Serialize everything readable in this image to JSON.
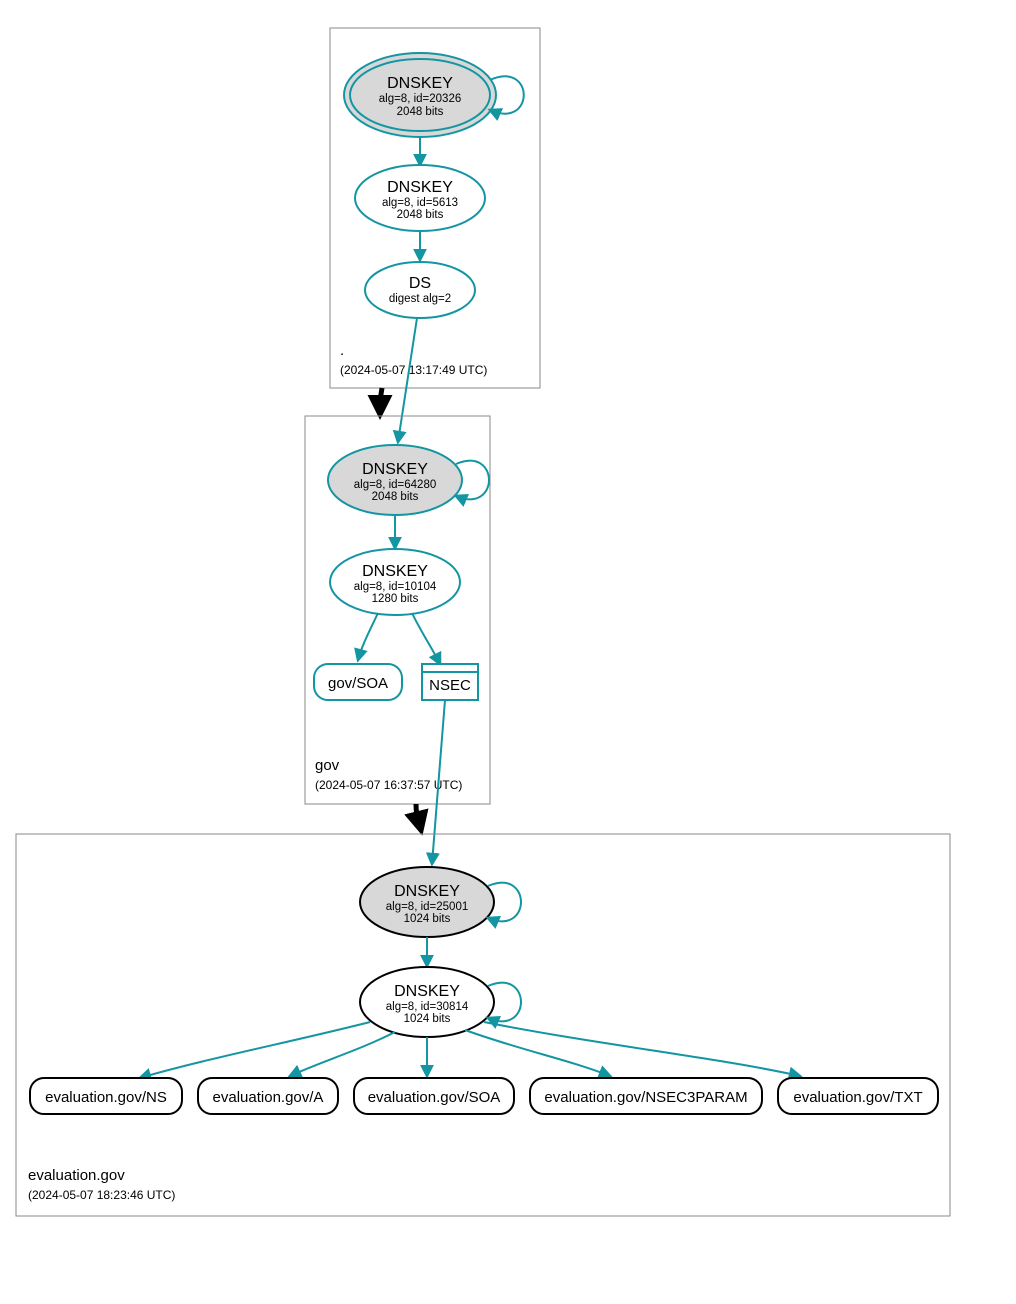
{
  "zones": {
    "root": {
      "label": ".",
      "timestamp": "(2024-05-07 13:17:49 UTC)",
      "dnskey_ksk": {
        "title": "DNSKEY",
        "line1": "alg=8, id=20326",
        "line2": "2048 bits"
      },
      "dnskey_zsk": {
        "title": "DNSKEY",
        "line1": "alg=8, id=5613",
        "line2": "2048 bits"
      },
      "ds": {
        "title": "DS",
        "line1": "digest alg=2"
      }
    },
    "gov": {
      "label": "gov",
      "timestamp": "(2024-05-07 16:37:57 UTC)",
      "dnskey_ksk": {
        "title": "DNSKEY",
        "line1": "alg=8, id=64280",
        "line2": "2048 bits"
      },
      "dnskey_zsk": {
        "title": "DNSKEY",
        "line1": "alg=8, id=10104",
        "line2": "1280 bits"
      },
      "soa": "gov/SOA",
      "nsec": "NSEC"
    },
    "target": {
      "label": "evaluation.gov",
      "timestamp": "(2024-05-07 18:23:46 UTC)",
      "dnskey_ksk": {
        "title": "DNSKEY",
        "line1": "alg=8, id=25001",
        "line2": "1024 bits"
      },
      "dnskey_zsk": {
        "title": "DNSKEY",
        "line1": "alg=8, id=30814",
        "line2": "1024 bits"
      },
      "rr": {
        "ns": "evaluation.gov/NS",
        "a": "evaluation.gov/A",
        "soa": "evaluation.gov/SOA",
        "nsec3param": "evaluation.gov/NSEC3PARAM",
        "txt": "evaluation.gov/TXT"
      }
    }
  }
}
